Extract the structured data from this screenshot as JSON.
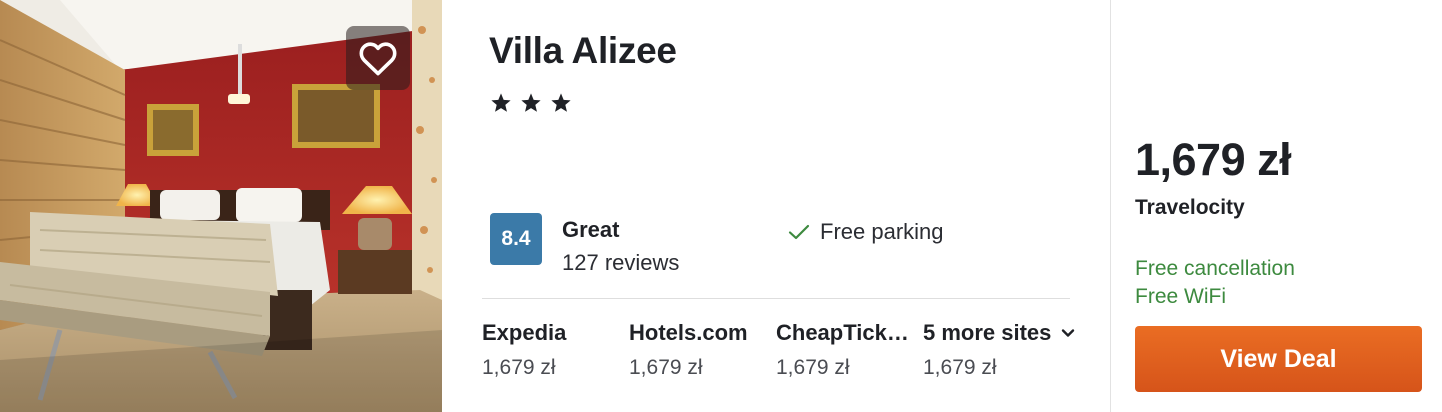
{
  "colors": {
    "score_badge": "#3b7aa8",
    "perk_green": "#3d8a3f",
    "cta_orange": "#e0601d",
    "text": "#1f2126"
  },
  "photo": {
    "favorite_icon": "heart-outline-icon"
  },
  "hotel": {
    "name": "Villa Alizee",
    "star_count": 3,
    "star_icon": "star-icon"
  },
  "rating": {
    "score": "8.4",
    "label": "Great",
    "reviews": "127 reviews"
  },
  "amenity": {
    "icon": "checkmark-icon",
    "label": "Free parking"
  },
  "sites": [
    {
      "name": "Expedia",
      "price": "1,679 zł"
    },
    {
      "name": "Hotels.com",
      "price": "1,679 zł"
    },
    {
      "name": "CheapTickets",
      "price": "1,679 zł"
    }
  ],
  "more_sites": {
    "label": "5 more sites",
    "price": "1,679 zł",
    "icon": "chevron-down-icon"
  },
  "deal": {
    "price": "1,679 zł",
    "provider": "Travelocity",
    "perks": [
      "Free cancellation",
      "Free WiFi"
    ],
    "cta_label": "View Deal"
  }
}
